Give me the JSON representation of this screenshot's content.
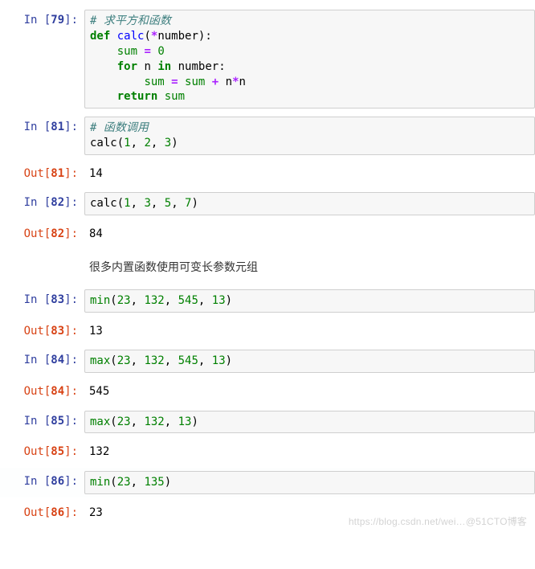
{
  "prompts": {
    "in": "In ",
    "out": "Out"
  },
  "cells": [
    {
      "type": "code",
      "num": "79",
      "out": null,
      "tokens": [
        [
          [
            "comment",
            "# 求平方和函数"
          ]
        ],
        [
          [
            "keyword",
            "def"
          ],
          [
            "name",
            " "
          ],
          [
            "def",
            "calc"
          ],
          [
            "paren",
            "("
          ],
          [
            "op",
            "*"
          ],
          [
            "name",
            "number"
          ],
          [
            "paren",
            ")"
          ],
          [
            "name",
            ":"
          ]
        ],
        [
          [
            "name",
            "    "
          ],
          [
            "builtin",
            "sum"
          ],
          [
            "name",
            " "
          ],
          [
            "op",
            "="
          ],
          [
            "name",
            " "
          ],
          [
            "num",
            "0"
          ]
        ],
        [
          [
            "name",
            "    "
          ],
          [
            "keyword",
            "for"
          ],
          [
            "name",
            " n "
          ],
          [
            "keyword",
            "in"
          ],
          [
            "name",
            " number"
          ],
          [
            "name",
            ":"
          ]
        ],
        [
          [
            "name",
            "        "
          ],
          [
            "builtin",
            "sum"
          ],
          [
            "name",
            " "
          ],
          [
            "op",
            "="
          ],
          [
            "name",
            " "
          ],
          [
            "builtin",
            "sum"
          ],
          [
            "name",
            " "
          ],
          [
            "op",
            "+"
          ],
          [
            "name",
            " n"
          ],
          [
            "op",
            "*"
          ],
          [
            "name",
            "n"
          ]
        ],
        [
          [
            "name",
            "    "
          ],
          [
            "keyword",
            "return"
          ],
          [
            "name",
            " "
          ],
          [
            "builtin",
            "sum"
          ]
        ]
      ]
    },
    {
      "type": "code",
      "num": "81",
      "out": "14",
      "tokens": [
        [
          [
            "comment",
            "# 函数调用"
          ]
        ],
        [
          [
            "name",
            "calc"
          ],
          [
            "paren",
            "("
          ],
          [
            "num",
            "1"
          ],
          [
            "name",
            ", "
          ],
          [
            "num",
            "2"
          ],
          [
            "name",
            ", "
          ],
          [
            "num",
            "3"
          ],
          [
            "paren",
            ")"
          ]
        ]
      ]
    },
    {
      "type": "code",
      "num": "82",
      "out": "84",
      "tokens": [
        [
          [
            "name",
            "calc"
          ],
          [
            "paren",
            "("
          ],
          [
            "num",
            "1"
          ],
          [
            "name",
            ", "
          ],
          [
            "num",
            "3"
          ],
          [
            "name",
            ", "
          ],
          [
            "num",
            "5"
          ],
          [
            "name",
            ", "
          ],
          [
            "num",
            "7"
          ],
          [
            "paren",
            ")"
          ]
        ]
      ]
    },
    {
      "type": "markdown",
      "text": "很多内置函数使用可变长参数元组"
    },
    {
      "type": "code",
      "num": "83",
      "out": "13",
      "tokens": [
        [
          [
            "builtin",
            "min"
          ],
          [
            "paren",
            "("
          ],
          [
            "num",
            "23"
          ],
          [
            "name",
            ", "
          ],
          [
            "num",
            "132"
          ],
          [
            "name",
            ", "
          ],
          [
            "num",
            "545"
          ],
          [
            "name",
            ", "
          ],
          [
            "num",
            "13"
          ],
          [
            "paren",
            ")"
          ]
        ]
      ]
    },
    {
      "type": "code",
      "num": "84",
      "out": "545",
      "tokens": [
        [
          [
            "builtin",
            "max"
          ],
          [
            "paren",
            "("
          ],
          [
            "num",
            "23"
          ],
          [
            "name",
            ", "
          ],
          [
            "num",
            "132"
          ],
          [
            "name",
            ", "
          ],
          [
            "num",
            "545"
          ],
          [
            "name",
            ", "
          ],
          [
            "num",
            "13"
          ],
          [
            "paren",
            ")"
          ]
        ]
      ]
    },
    {
      "type": "code",
      "num": "85",
      "out": "132",
      "tokens": [
        [
          [
            "builtin",
            "max"
          ],
          [
            "paren",
            "("
          ],
          [
            "num",
            "23"
          ],
          [
            "name",
            ", "
          ],
          [
            "num",
            "132"
          ],
          [
            "name",
            ", "
          ],
          [
            "num",
            "13"
          ],
          [
            "paren",
            ")"
          ]
        ]
      ]
    },
    {
      "type": "code",
      "num": "86",
      "out": "23",
      "selected": true,
      "tokens": [
        [
          [
            "builtin",
            "min"
          ],
          [
            "paren",
            "("
          ],
          [
            "num",
            "23"
          ],
          [
            "name",
            ", "
          ],
          [
            "num",
            "135"
          ],
          [
            "paren",
            ")"
          ]
        ]
      ]
    }
  ],
  "watermark": "https://blog.csdn.net/wei…@51CTO博客"
}
